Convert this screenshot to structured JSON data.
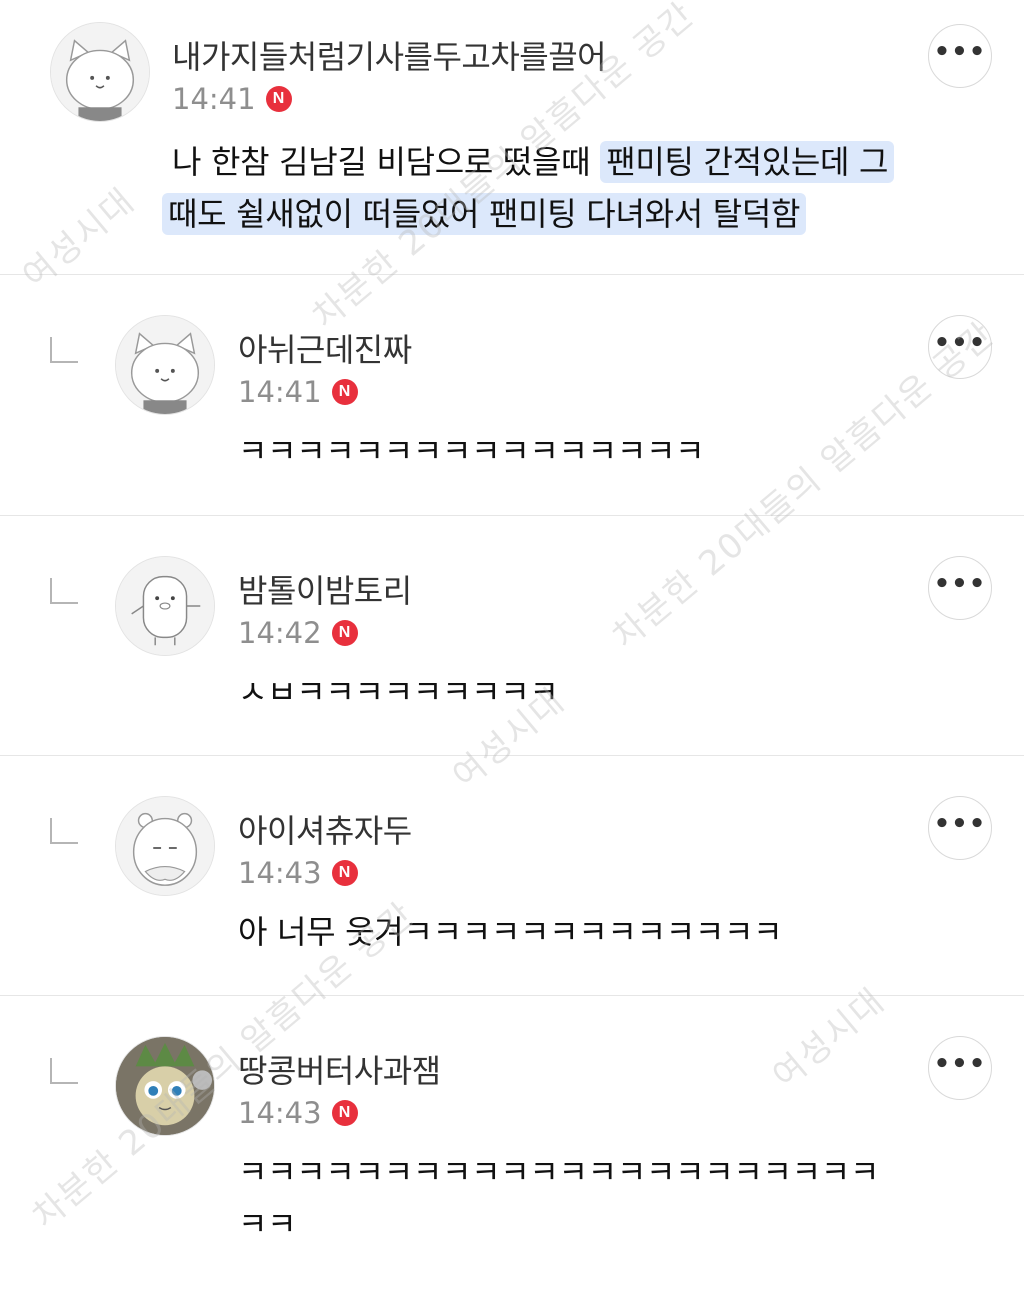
{
  "comments": [
    {
      "nickname": "내가지들처럼기사를두고차를끌어",
      "time": "14:41",
      "badge": "N",
      "avatar_icon": "bear-avatar-icon",
      "text_plain": "나 한참 김남길 비담으로 떴을때 ",
      "text_highlight_1": "팬미팅 간적있는데 그",
      "text_highlight_2": "때도 쉴새없이 떠들었어 팬미팅 다녀와서 탈덕함",
      "more_label": "•••"
    },
    {
      "nickname": "아뉘근데진짜",
      "time": "14:41",
      "badge": "N",
      "avatar_icon": "bear-avatar-icon",
      "text": "ㅋㅋㅋㅋㅋㅋㅋㅋㅋㅋㅋㅋㅋㅋㅋㅋ",
      "more_label": "•••"
    },
    {
      "nickname": "밤톨이밤토리",
      "time": "14:42",
      "badge": "N",
      "avatar_icon": "penguin-avatar-icon",
      "text": "ㅅㅂㅋㅋㅋㅋㅋㅋㅋㅋㅋ",
      "more_label": "•••"
    },
    {
      "nickname": "아이셔츄자두",
      "time": "14:43",
      "badge": "N",
      "avatar_icon": "hamster-avatar-icon",
      "text": "아 너무 웃겨ㅋㅋㅋㅋㅋㅋㅋㅋㅋㅋㅋㅋㅋ",
      "more_label": "•••"
    },
    {
      "nickname": "땅콩버터사과잼",
      "time": "14:43",
      "badge": "N",
      "avatar_icon": "character-avatar-icon",
      "text_line1": "ㅋㅋㅋㅋㅋㅋㅋㅋㅋㅋㅋㅋㅋㅋㅋㅋㅋㅋㅋㅋㅋㅋ",
      "text_line2": "ㅋㅋ",
      "more_label": "•••"
    }
  ],
  "watermark": {
    "text_a": "여성시대",
    "text_b": "차분한 20대들의 알흠다운 공간"
  }
}
